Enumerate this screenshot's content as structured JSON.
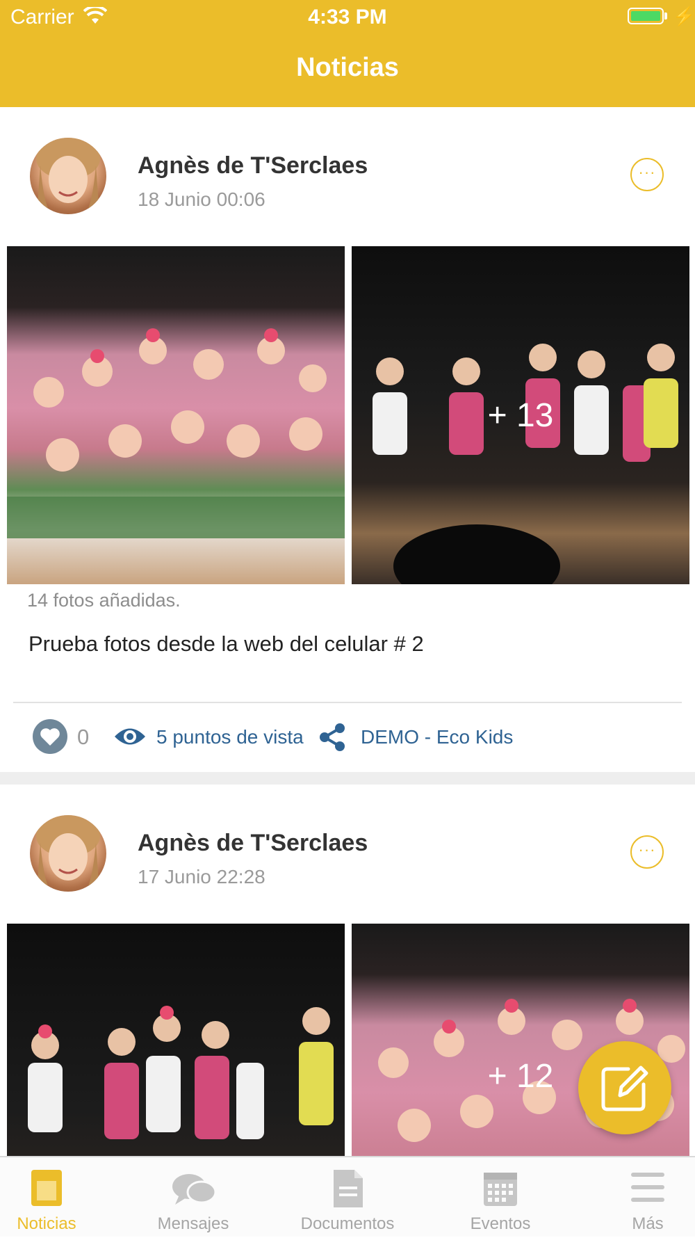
{
  "status_bar": {
    "carrier": "Carrier",
    "time": "4:33 PM"
  },
  "header": {
    "title": "Noticias"
  },
  "posts": [
    {
      "author": "Agnès de T'Serclaes",
      "date": "18 Junio 00:06",
      "more_glyph": "···",
      "extra_photos": "+ 13",
      "photos_added": "14 fotos añadidas.",
      "caption": "Prueba fotos desde la web del celular # 2",
      "likes": "0",
      "views": "5 puntos de vista",
      "school": "DEMO - Eco Kids"
    },
    {
      "author": "Agnès de T'Serclaes",
      "date": "17 Junio 22:28",
      "more_glyph": "···",
      "extra_photos": "+ 12"
    }
  ],
  "tabbar": {
    "items": [
      {
        "label": "Noticias",
        "icon": "news-icon",
        "active": true
      },
      {
        "label": "Mensajes",
        "icon": "messages-icon"
      },
      {
        "label": "Documentos",
        "icon": "document-icon"
      },
      {
        "label": "Eventos",
        "icon": "calendar-icon"
      },
      {
        "label": "Más",
        "icon": "menu-icon"
      }
    ]
  },
  "colors": {
    "accent": "#ebbd2a",
    "link": "#2f6393",
    "like": "#6f8799"
  }
}
